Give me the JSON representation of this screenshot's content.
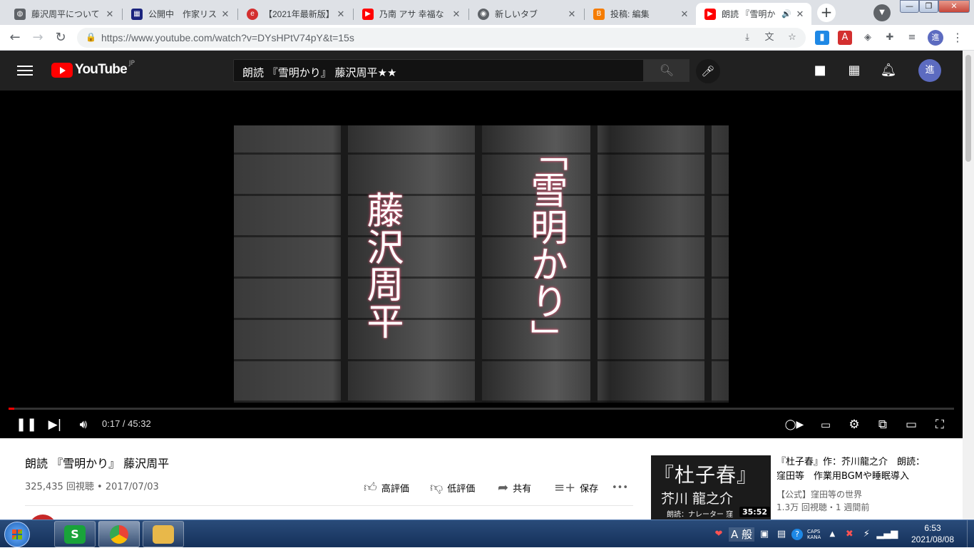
{
  "browser": {
    "tabs": [
      {
        "label": "藤沢周平について",
        "favicon": "globe-icon",
        "color": "#5f6368"
      },
      {
        "label": "公開中　作家リス",
        "favicon": "library-icon",
        "color": "#1a237e"
      },
      {
        "label": "【2021年最新版】",
        "favicon": "web-icon",
        "color": "#d32f2f"
      },
      {
        "label": "乃南 アサ 幸福な",
        "favicon": "youtube-icon",
        "color": "#ff0000"
      },
      {
        "label": "新しいタブ",
        "favicon": "chrome-icon",
        "color": "#5f6368"
      },
      {
        "label": "投稿: 編集",
        "favicon": "blogger-icon",
        "color": "#f57c00"
      },
      {
        "label": "朗読 『雪明か",
        "favicon": "youtube-icon",
        "color": "#ff0000",
        "active": true,
        "audio": "🔊"
      }
    ],
    "new_tab": "+",
    "url": "https://www.youtube.com/watch?v=DYsHPtV74pY&t=15s",
    "profile_initial": "進",
    "window_buttons": {
      "minimize": "—",
      "maximize": "❐",
      "close": "✕"
    }
  },
  "youtube": {
    "logo_text": "YouTube",
    "region": "JP",
    "search_query": "朗読 『雪明かり』 藤沢周平★★",
    "avatar_initial": "進"
  },
  "player": {
    "frame_title": "「雪明かり」",
    "frame_author": "藤沢周平",
    "time": "0:17 / 45:32",
    "progress": 0.0062
  },
  "video": {
    "title": "朗読 『雪明かり』 藤沢周平",
    "meta": "325,435 回視聴 • 2017/07/03",
    "actions": {
      "like": "高評価",
      "dislike": "低評価",
      "share": "共有",
      "save": "保存",
      "more": "•••"
    }
  },
  "recommendation": {
    "thumb_title": "『杜子春』",
    "thumb_author": "芥川 龍之介",
    "thumb_narrator": "朗読：ナレーター 窪",
    "duration": "35:52",
    "title": "『杜子春』作：芥川龍之介　朗読：窪田等　作業用BGMや睡眠導入",
    "channel": "【公式】窪田等の世界",
    "meta": "1.3万 回視聴・1 週間前"
  },
  "taskbar": {
    "ime_mode": "A 般",
    "caps": "CAPS",
    "kana": "KANA",
    "time": "6:53",
    "date": "2021/08/08"
  }
}
